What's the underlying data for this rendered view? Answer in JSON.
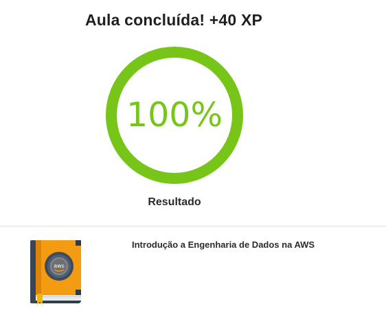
{
  "header": {
    "title": "Aula concluída! +40 XP"
  },
  "result": {
    "progress_label": "100%",
    "progress_fraction": 1.0,
    "caption": "Resultado",
    "accent_color": "#78c51a",
    "track_color": "#e6e6e6"
  },
  "course": {
    "title": "Introdução a Engenharia de Dados na AWS",
    "thumbnail_icon": "aws-book-icon",
    "thumbnail_text": "aws"
  }
}
